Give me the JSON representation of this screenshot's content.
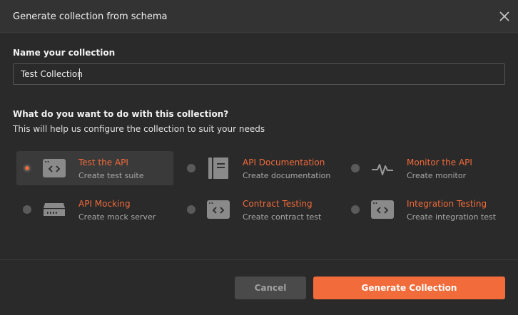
{
  "header": {
    "title": "Generate collection from schema"
  },
  "name_section": {
    "label": "Name your collection",
    "input_value": "Test Collection"
  },
  "purpose_section": {
    "question": "What do you want to do with this collection?",
    "subtext": "This will help us configure the collection to suit your needs"
  },
  "options": [
    {
      "title": "Test the API",
      "desc": "Create test suite",
      "icon": "code-window-icon",
      "selected": true
    },
    {
      "title": "API Documentation",
      "desc": "Create documentation",
      "icon": "document-icon",
      "selected": false
    },
    {
      "title": "Monitor the API",
      "desc": "Create monitor",
      "icon": "pulse-icon",
      "selected": false
    },
    {
      "title": "API Mocking",
      "desc": "Create mock server",
      "icon": "server-icon",
      "selected": false
    },
    {
      "title": "Contract Testing",
      "desc": "Create contract test",
      "icon": "code-window-icon",
      "selected": false
    },
    {
      "title": "Integration Testing",
      "desc": "Create integration test",
      "icon": "code-window-icon",
      "selected": false
    }
  ],
  "footer": {
    "cancel_label": "Cancel",
    "generate_label": "Generate Collection"
  },
  "colors": {
    "accent": "#f26b3a",
    "background": "#2a2a2a",
    "header": "#333333"
  }
}
